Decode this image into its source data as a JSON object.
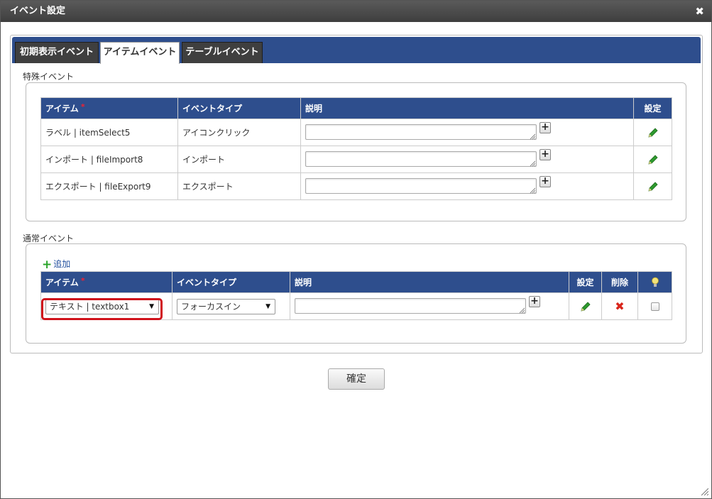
{
  "dialog": {
    "title": "イベント設定",
    "close_glyph": "✖"
  },
  "tabs": [
    {
      "label": "初期表示イベント",
      "active": false
    },
    {
      "label": "アイテムイベント",
      "active": true
    },
    {
      "label": "テーブルイベント",
      "active": false
    }
  ],
  "special_events": {
    "section_title": "特殊イベント",
    "columns": {
      "item": "アイテム",
      "required_mark": "*",
      "event_type": "イベントタイプ",
      "description": "説明",
      "settings": "設定"
    },
    "rows": [
      {
        "item": "ラベル | itemSelect5",
        "event_type": "アイコンクリック",
        "description": ""
      },
      {
        "item": "インポート | fileImport8",
        "event_type": "インポート",
        "description": ""
      },
      {
        "item": "エクスポート | fileExport9",
        "event_type": "エクスポート",
        "description": ""
      }
    ]
  },
  "normal_events": {
    "section_title": "通常イベント",
    "add_label": "追加",
    "columns": {
      "item": "アイテム",
      "required_mark": "*",
      "event_type": "イベントタイプ",
      "description": "説明",
      "settings": "設定",
      "delete": "削除",
      "bulb_icon": "lightbulb-icon"
    },
    "rows": [
      {
        "item": "テキスト | textbox1",
        "event_type": "フォーカスイン",
        "description": "",
        "checked": false
      }
    ]
  },
  "footer": {
    "confirm_label": "確定"
  },
  "colors": {
    "header_blue": "#2e4e8d",
    "title_bar": "#4a4a4a",
    "highlight_red": "#d0121b",
    "pencil_green": "#2f9a2f",
    "delete_red": "#d9261c"
  }
}
